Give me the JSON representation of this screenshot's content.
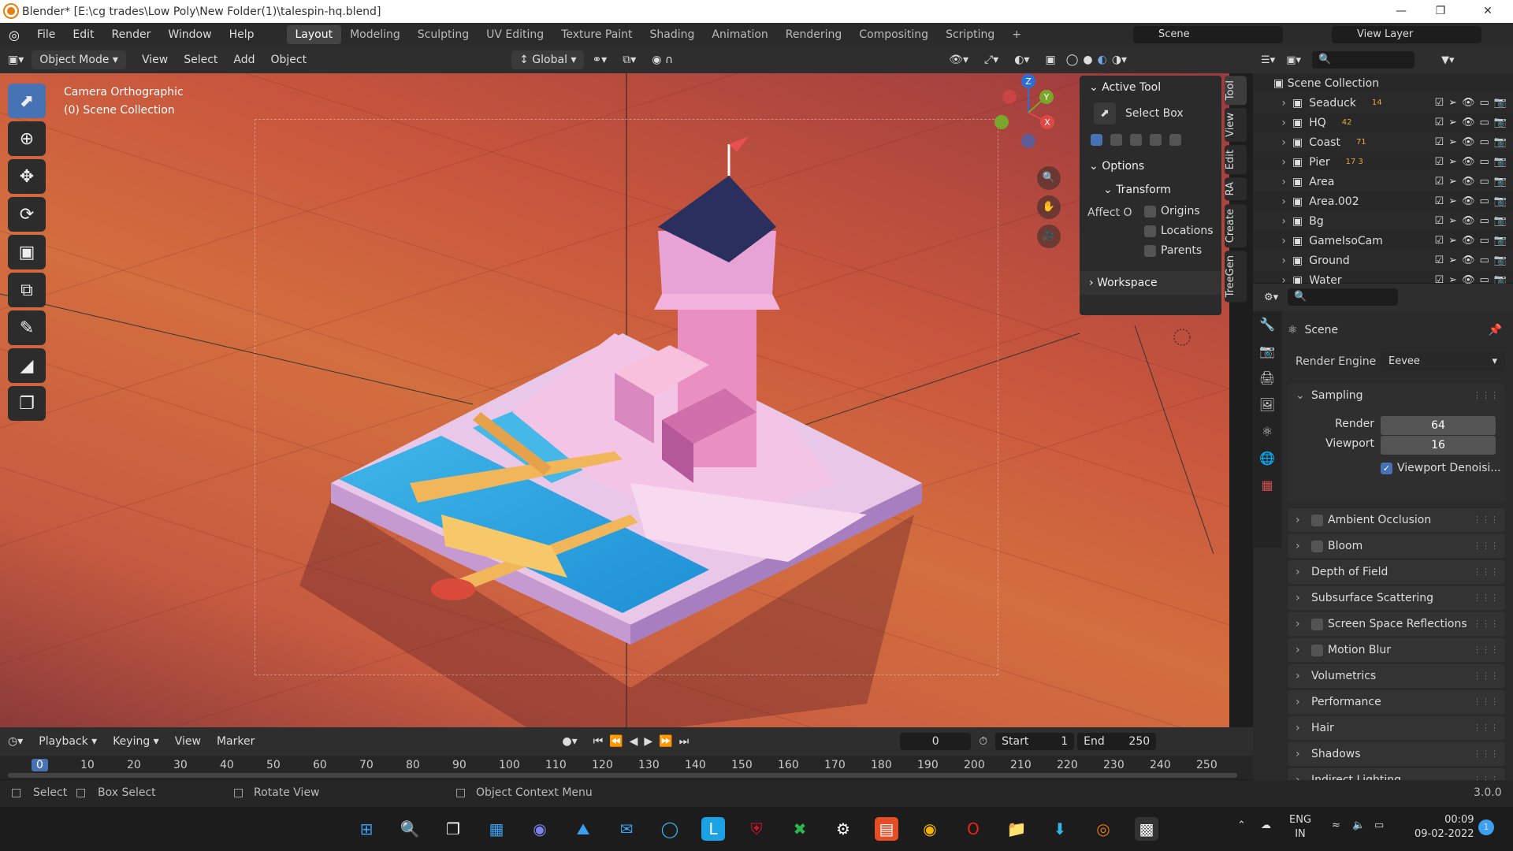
{
  "window": {
    "title": "Blender* [E:\\cg trades\\Low Poly\\New Folder(1)\\talespin-hq.blend]"
  },
  "menu": {
    "items": [
      "File",
      "Edit",
      "Render",
      "Window",
      "Help"
    ],
    "workspaces": [
      "Layout",
      "Modeling",
      "Sculpting",
      "UV Editing",
      "Texture Paint",
      "Shading",
      "Animation",
      "Rendering",
      "Compositing",
      "Scripting"
    ],
    "add_workspace": "+",
    "scene": "Scene",
    "view_layer": "View Layer"
  },
  "viewport_header": {
    "mode": "Object Mode",
    "menus": [
      "View",
      "Select",
      "Add",
      "Object"
    ],
    "orientation": "Global"
  },
  "viewport": {
    "camera_label": "Camera Orthographic",
    "collection_label": "(0) Scene Collection"
  },
  "gizmo": {
    "z": "Z",
    "y": "Y",
    "x": "X"
  },
  "npanel": {
    "active_tool": "Active Tool",
    "tool_name": "Select Box",
    "options": "Options",
    "transform": "Transform",
    "affect_only": "Affect O",
    "origins": "Origins",
    "locations": "Locations",
    "parents": "Parents",
    "workspace": "Workspace"
  },
  "side_tabs": [
    "Tool",
    "View",
    "Edit",
    "RA",
    "Create",
    "TreeGen"
  ],
  "outliner": {
    "root": "Scene Collection",
    "items": [
      {
        "name": "Seaduck",
        "badge": "14"
      },
      {
        "name": "HQ",
        "badge": "42"
      },
      {
        "name": "Coast",
        "badge": "71"
      },
      {
        "name": "Pier",
        "badge": "17 3"
      },
      {
        "name": "Area",
        "badge": ""
      },
      {
        "name": "Area.002",
        "badge": ""
      },
      {
        "name": "Bg",
        "badge": ""
      },
      {
        "name": "GameIsoCam",
        "badge": ""
      },
      {
        "name": "Ground",
        "badge": ""
      },
      {
        "name": "Water",
        "badge": ""
      }
    ]
  },
  "properties": {
    "scene": "Scene",
    "render_engine_label": "Render Engine",
    "render_engine": "Eevee",
    "sampling": "Sampling",
    "render_label": "Render",
    "render_val": "64",
    "viewport_label": "Viewport",
    "viewport_val": "16",
    "denoise": "Viewport Denoisi...",
    "sections": [
      "Ambient Occlusion",
      "Bloom",
      "Depth of Field",
      "Subsurface Scattering",
      "Screen Space Reflections",
      "Motion Blur",
      "Volumetrics",
      "Performance",
      "Hair",
      "Shadows",
      "Indirect Lighting"
    ]
  },
  "timeline": {
    "menus": [
      "Playback",
      "Keying",
      "View",
      "Marker"
    ],
    "frame": "0",
    "start_label": "Start",
    "start": "1",
    "end_label": "End",
    "end": "250",
    "current": "0",
    "ticks": [
      "10",
      "20",
      "30",
      "40",
      "50",
      "60",
      "70",
      "80",
      "90",
      "100",
      "110",
      "120",
      "130",
      "140",
      "150",
      "160",
      "170",
      "180",
      "190",
      "200",
      "210",
      "220",
      "230",
      "240",
      "250"
    ]
  },
  "status": {
    "select": "Select",
    "box": "Box Select",
    "rotate": "Rotate View",
    "ctx": "Object Context Menu",
    "version": "3.0.0"
  },
  "taskbar": {
    "lang1": "ENG",
    "lang2": "IN",
    "time": "00:09",
    "date": "09-02-2022",
    "notif": "1"
  }
}
